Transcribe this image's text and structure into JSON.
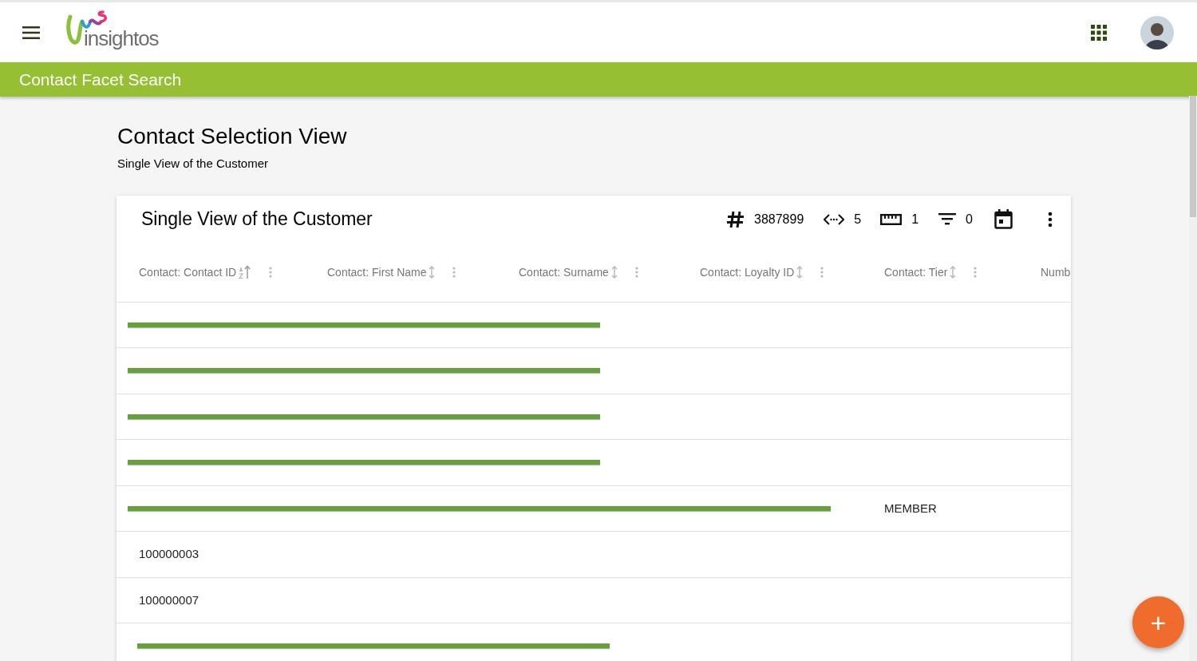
{
  "app": {
    "logo_text": "insightos"
  },
  "page_bar": {
    "title": "Contact Facet Search"
  },
  "view": {
    "title": "Contact Selection View",
    "subtitle": "Single View of the Customer"
  },
  "card": {
    "title": "Single View of the Customer",
    "stats": [
      {
        "kind": "count",
        "value": "3887899"
      },
      {
        "kind": "dimensions",
        "value": "5"
      },
      {
        "kind": "measures",
        "value": "1"
      },
      {
        "kind": "filters",
        "value": "0"
      }
    ],
    "columns": [
      {
        "label": "Contact: Contact ID",
        "kind": "sorted"
      },
      {
        "label": "Contact: First Name",
        "kind": "sortable"
      },
      {
        "label": "Contact: Surname",
        "kind": "sortable"
      },
      {
        "label": "Contact: Loyalty ID",
        "kind": "sortable"
      },
      {
        "label": "Contact: Tier",
        "kind": "sortable"
      },
      {
        "label": "Numb",
        "kind": "cut"
      }
    ],
    "rows": [
      {
        "kind": "redacted"
      },
      {
        "kind": "redacted"
      },
      {
        "kind": "redacted"
      },
      {
        "kind": "redacted"
      },
      {
        "kind": "redacted_wide",
        "tier": "MEMBER"
      },
      {
        "kind": "plain",
        "contact_id": "100000003"
      },
      {
        "kind": "plain",
        "contact_id": "100000007"
      },
      {
        "kind": "redacted"
      }
    ]
  },
  "fab": {
    "label": "+"
  }
}
